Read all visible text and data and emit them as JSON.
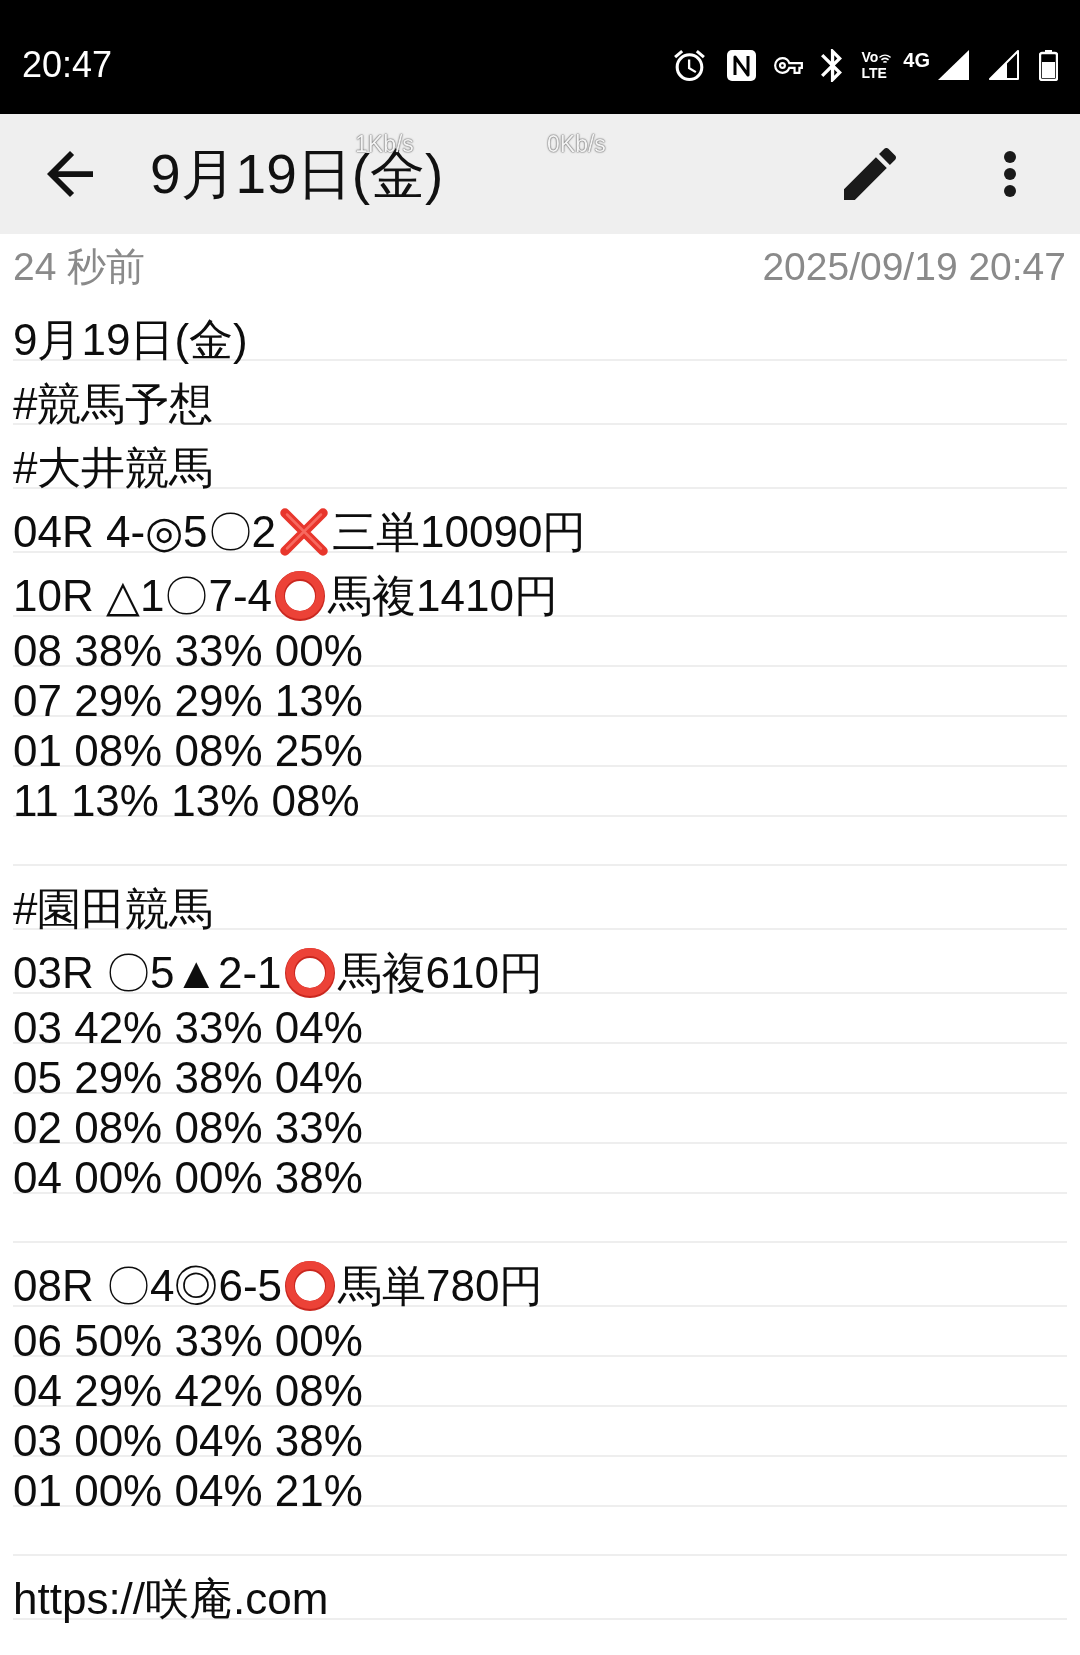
{
  "status_bar": {
    "time": "20:47",
    "volte": {
      "top": "Vo",
      "bottom": "LTE"
    },
    "network": "4G"
  },
  "toolbar": {
    "title": "9月19日(金)",
    "network_speed": [
      "1Kb/s",
      "0Kb/s"
    ]
  },
  "note": {
    "age": "24 秒前",
    "timestamp": "2025/09/19 20:47",
    "lines": [
      {
        "kind": "text",
        "text": "9月19日(金)"
      },
      {
        "kind": "text",
        "text": "#競馬予想"
      },
      {
        "kind": "text",
        "text": "#大井競馬"
      },
      {
        "kind": "marked",
        "parts": [
          {
            "kind": "text",
            "text": "04R 4-◎5〇2"
          },
          {
            "kind": "cross"
          },
          {
            "kind": "text",
            "text": "三単10090円"
          }
        ]
      },
      {
        "kind": "marked",
        "parts": [
          {
            "kind": "text",
            "text": "10R △1〇7-4"
          },
          {
            "kind": "ring"
          },
          {
            "kind": "text",
            "text": "馬複1410円"
          }
        ]
      },
      {
        "kind": "text",
        "text": "08 38% 33% 00%"
      },
      {
        "kind": "text",
        "text": "07 29% 29% 13%"
      },
      {
        "kind": "text",
        "text": "01 08% 08% 25%"
      },
      {
        "kind": "text",
        "text": "11 13% 13% 08%"
      },
      {
        "kind": "blank"
      },
      {
        "kind": "text",
        "text": "#園田競馬"
      },
      {
        "kind": "marked",
        "parts": [
          {
            "kind": "text",
            "text": "03R 〇5▲2-1"
          },
          {
            "kind": "ring"
          },
          {
            "kind": "text",
            "text": "馬複610円"
          }
        ]
      },
      {
        "kind": "text",
        "text": "03 42% 33% 04%"
      },
      {
        "kind": "text",
        "text": "05 29% 38% 04%"
      },
      {
        "kind": "text",
        "text": "02 08% 08% 33%"
      },
      {
        "kind": "text",
        "text": "04 00% 00% 38%"
      },
      {
        "kind": "blank"
      },
      {
        "kind": "marked",
        "parts": [
          {
            "kind": "text",
            "text": "08R 〇4◎6-5"
          },
          {
            "kind": "ring"
          },
          {
            "kind": "text",
            "text": "馬単780円"
          }
        ]
      },
      {
        "kind": "text",
        "text": "06 50% 33% 00%"
      },
      {
        "kind": "text",
        "text": "04 29% 42% 08%"
      },
      {
        "kind": "text",
        "text": "03 00% 04% 38%"
      },
      {
        "kind": "text",
        "text": "01 00% 04% 21%"
      },
      {
        "kind": "blank"
      },
      {
        "kind": "text",
        "text": "https://咲庵.com"
      }
    ]
  }
}
